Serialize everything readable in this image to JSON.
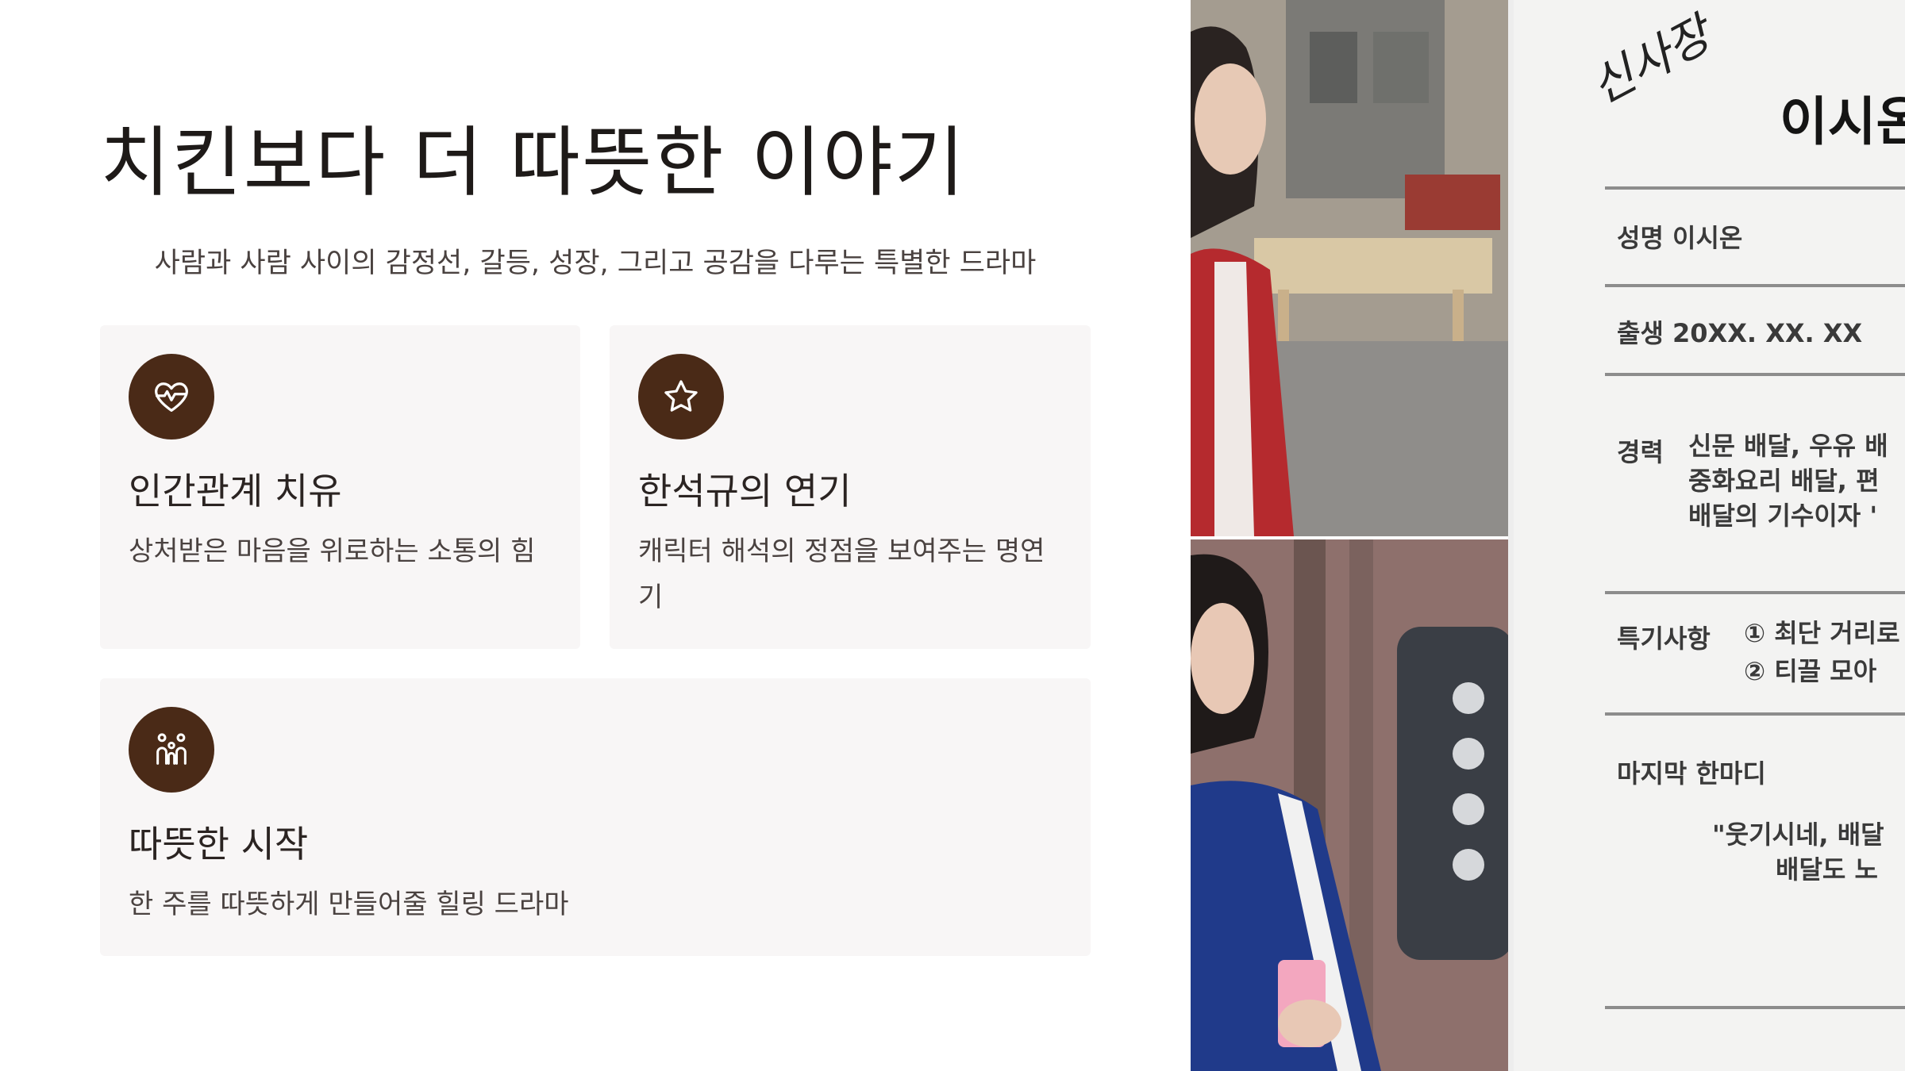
{
  "slide": {
    "title": "치킨보다 더 따뜻한 이야기",
    "subtitle": "사람과 사람 사이의 감정선, 갈등, 성장, 그리고 공감을 다루는 특별한 드라마"
  },
  "cards": [
    {
      "icon": "heart-pulse-icon",
      "title": "인간관계 치유",
      "desc": "상처받은 마음을 위로하는 소통의 힘"
    },
    {
      "icon": "star-icon",
      "title": "한석규의 연기",
      "desc": "캐릭터 해석의 정점을 보여주는 명연기"
    },
    {
      "icon": "family-icon",
      "title": "따뜻한 시작",
      "desc": "한 주를 따뜻하게 만들어줄 힐링 드라마"
    }
  ],
  "document": {
    "signature": "신사장",
    "name": "이시온",
    "field_name": "성명 이시온",
    "field_birth": "출생 20XX. XX. XX",
    "career_label": "경력",
    "career_1": "신문 배달, 우유 배",
    "career_2": "중화요리 배달, 편",
    "career_3": "배달의 기수이자 '",
    "special_label": "특기사항",
    "special_1": "① 최단 거리로",
    "special_2": "② 티끌 모아",
    "last_word_label": "마지막 한마디",
    "quote_1": "\"웃기시네, 배달",
    "quote_2": "배달도 노"
  },
  "colors": {
    "accent": "#4a2a17",
    "card_bg": "#f8f6f6",
    "title_text": "#1e1a18"
  }
}
